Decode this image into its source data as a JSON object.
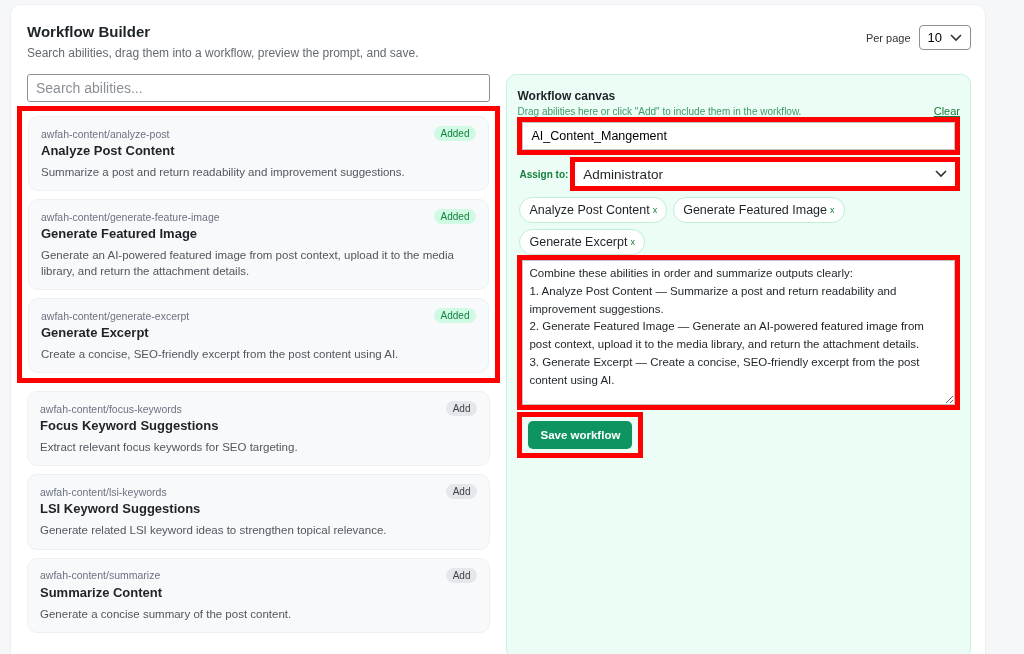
{
  "header": {
    "title": "Workflow Builder",
    "subtitle": "Search abilities, drag them into a workflow, preview the prompt, and save.",
    "per_page_label": "Per page",
    "per_page": "10"
  },
  "search": {
    "placeholder": "Search abilities..."
  },
  "abilities": [
    {
      "slug": "awfah-content/analyze-post",
      "name": "Analyze Post Content",
      "description": "Summarize a post and return readability and improvement suggestions.",
      "added": true,
      "status": "Added",
      "highlighted": true
    },
    {
      "slug": "awfah-content/generate-feature-image",
      "name": "Generate Featured Image",
      "description": "Generate an AI-powered featured image from post context, upload it to the media library, and return the attachment details.",
      "added": true,
      "status": "Added",
      "highlighted": true
    },
    {
      "slug": "awfah-content/generate-excerpt",
      "name": "Generate Excerpt",
      "description": "Create a concise, SEO-friendly excerpt from the post content using AI.",
      "added": true,
      "status": "Added",
      "highlighted": true
    },
    {
      "slug": "awfah-content/focus-keywords",
      "name": "Focus Keyword Suggestions",
      "description": "Extract relevant focus keywords for SEO targeting.",
      "added": false,
      "status": "Add",
      "highlighted": false
    },
    {
      "slug": "awfah-content/lsi-keywords",
      "name": "LSI Keyword Suggestions",
      "description": "Generate related LSI keyword ideas to strengthen topical relevance.",
      "added": false,
      "status": "Add",
      "highlighted": false
    },
    {
      "slug": "awfah-content/summarize",
      "name": "Summarize Content",
      "description": "Generate a concise summary of the post content.",
      "added": false,
      "status": "Add",
      "highlighted": false
    }
  ],
  "canvas": {
    "title": "Workflow canvas",
    "hint": "Drag abilities here or click \"Add\" to include them in the workflow.",
    "clear": "Clear",
    "name": {
      "value": "AI_Content_Mangement",
      "highlighted": true
    },
    "assign_label": "Assign to:",
    "assign": {
      "value": "Administrator",
      "highlighted": true
    },
    "chips": [
      {
        "label": "Analyze Post Content",
        "remove": "x"
      },
      {
        "label": "Generate Featured Image",
        "remove": "x"
      },
      {
        "label": "Generate Excerpt",
        "remove": "x"
      }
    ],
    "prompt": {
      "value": "Combine these abilities in order and summarize outputs clearly:\n1. Analyze Post Content — Summarize a post and return readability and improvement suggestions.\n2. Generate Featured Image — Generate an AI-powered featured image from post context, upload it to the media library, and return the attachment details.\n3. Generate Excerpt — Create a concise, SEO-friendly excerpt from the post content using AI.",
      "highlighted": true
    },
    "save": {
      "label": "Save workflow",
      "highlighted": true
    }
  }
}
